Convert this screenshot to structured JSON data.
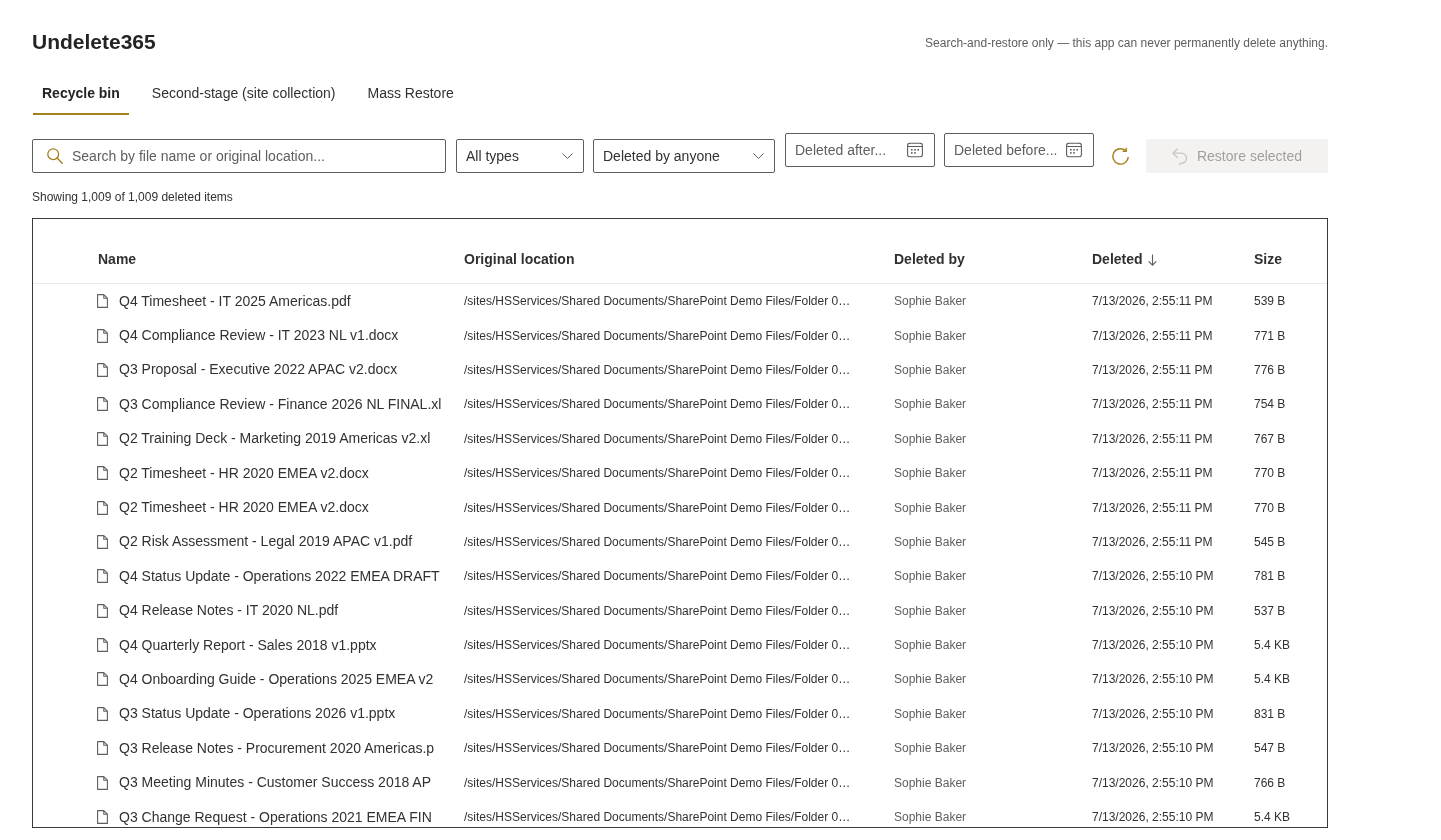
{
  "app": {
    "title": "Undelete365",
    "notice": "Search-and-restore only — this app can never permanently delete anything."
  },
  "tabs": [
    {
      "label": "Recycle bin",
      "selected": true
    },
    {
      "label": "Second-stage (site collection)",
      "selected": false
    },
    {
      "label": "Mass Restore",
      "selected": false
    }
  ],
  "toolbar": {
    "search": {
      "placeholder": "Search by file name or original location..."
    },
    "filters": [
      {
        "kind": "dropdown",
        "value": "All types"
      },
      {
        "kind": "dropdown",
        "value": "Deleted by anyone"
      },
      {
        "kind": "date",
        "placeholder": "Deleted after..."
      },
      {
        "kind": "date",
        "placeholder": "Deleted before..."
      }
    ],
    "restore_button": {
      "label": "Restore selected",
      "disabled": true
    }
  },
  "summary": "Showing 1,009 of 1,009 deleted items",
  "table": {
    "columns": [
      {
        "label": "Name",
        "sort_descending": false
      },
      {
        "label": "Original location",
        "sort_descending": false
      },
      {
        "label": "Deleted by",
        "sort_descending": false
      },
      {
        "label": "Deleted",
        "sort_descending": true
      },
      {
        "label": "Size",
        "sort_descending": false
      }
    ],
    "rows": [
      {
        "name": "Q4 Timesheet - IT 2025 Americas.pdf",
        "location": "/sites/HSServices/Shared Documents/SharePoint Demo Files/Folder 0…",
        "deleted_by": "Sophie Baker",
        "deleted": "7/13/2026, 2:55:11 PM",
        "size": "539 B"
      },
      {
        "name": "Q4 Compliance Review - IT 2023 NL v1.docx",
        "location": "/sites/HSServices/Shared Documents/SharePoint Demo Files/Folder 0…",
        "deleted_by": "Sophie Baker",
        "deleted": "7/13/2026, 2:55:11 PM",
        "size": "771 B"
      },
      {
        "name": "Q3 Proposal - Executive 2022 APAC v2.docx",
        "location": "/sites/HSServices/Shared Documents/SharePoint Demo Files/Folder 0…",
        "deleted_by": "Sophie Baker",
        "deleted": "7/13/2026, 2:55:11 PM",
        "size": "776 B"
      },
      {
        "name": "Q3 Compliance Review - Finance 2026 NL FINAL.xl",
        "location": "/sites/HSServices/Shared Documents/SharePoint Demo Files/Folder 0…",
        "deleted_by": "Sophie Baker",
        "deleted": "7/13/2026, 2:55:11 PM",
        "size": "754 B"
      },
      {
        "name": "Q2 Training Deck - Marketing 2019 Americas v2.xl",
        "location": "/sites/HSServices/Shared Documents/SharePoint Demo Files/Folder 0…",
        "deleted_by": "Sophie Baker",
        "deleted": "7/13/2026, 2:55:11 PM",
        "size": "767 B"
      },
      {
        "name": "Q2 Timesheet - HR 2020 EMEA v2.docx",
        "location": "/sites/HSServices/Shared Documents/SharePoint Demo Files/Folder 0…",
        "deleted_by": "Sophie Baker",
        "deleted": "7/13/2026, 2:55:11 PM",
        "size": "770 B"
      },
      {
        "name": "Q2 Timesheet - HR 2020 EMEA v2.docx",
        "location": "/sites/HSServices/Shared Documents/SharePoint Demo Files/Folder 0…",
        "deleted_by": "Sophie Baker",
        "deleted": "7/13/2026, 2:55:11 PM",
        "size": "770 B"
      },
      {
        "name": "Q2 Risk Assessment - Legal 2019 APAC v1.pdf",
        "location": "/sites/HSServices/Shared Documents/SharePoint Demo Files/Folder 0…",
        "deleted_by": "Sophie Baker",
        "deleted": "7/13/2026, 2:55:11 PM",
        "size": "545 B"
      },
      {
        "name": "Q4 Status Update - Operations 2022 EMEA DRAFT",
        "location": "/sites/HSServices/Shared Documents/SharePoint Demo Files/Folder 0…",
        "deleted_by": "Sophie Baker",
        "deleted": "7/13/2026, 2:55:10 PM",
        "size": "781 B"
      },
      {
        "name": "Q4 Release Notes - IT 2020 NL.pdf",
        "location": "/sites/HSServices/Shared Documents/SharePoint Demo Files/Folder 0…",
        "deleted_by": "Sophie Baker",
        "deleted": "7/13/2026, 2:55:10 PM",
        "size": "537 B"
      },
      {
        "name": "Q4 Quarterly Report - Sales 2018 v1.pptx",
        "location": "/sites/HSServices/Shared Documents/SharePoint Demo Files/Folder 0…",
        "deleted_by": "Sophie Baker",
        "deleted": "7/13/2026, 2:55:10 PM",
        "size": "5.4 KB"
      },
      {
        "name": "Q4 Onboarding Guide - Operations 2025 EMEA v2",
        "location": "/sites/HSServices/Shared Documents/SharePoint Demo Files/Folder 0…",
        "deleted_by": "Sophie Baker",
        "deleted": "7/13/2026, 2:55:10 PM",
        "size": "5.4 KB"
      },
      {
        "name": "Q3 Status Update - Operations 2026 v1.pptx",
        "location": "/sites/HSServices/Shared Documents/SharePoint Demo Files/Folder 0…",
        "deleted_by": "Sophie Baker",
        "deleted": "7/13/2026, 2:55:10 PM",
        "size": "831 B"
      },
      {
        "name": "Q3 Release Notes - Procurement 2020 Americas.p",
        "location": "/sites/HSServices/Shared Documents/SharePoint Demo Files/Folder 0…",
        "deleted_by": "Sophie Baker",
        "deleted": "7/13/2026, 2:55:10 PM",
        "size": "547 B"
      },
      {
        "name": "Q3 Meeting Minutes - Customer Success 2018 AP",
        "location": "/sites/HSServices/Shared Documents/SharePoint Demo Files/Folder 0…",
        "deleted_by": "Sophie Baker",
        "deleted": "7/13/2026, 2:55:10 PM",
        "size": "766 B"
      },
      {
        "name": "Q3 Change Request - Operations 2021 EMEA FIN",
        "location": "/sites/HSServices/Shared Documents/SharePoint Demo Files/Folder 0…",
        "deleted_by": "Sophie Baker",
        "deleted": "7/13/2026, 2:55:10 PM",
        "size": "5.4 KB"
      }
    ]
  }
}
